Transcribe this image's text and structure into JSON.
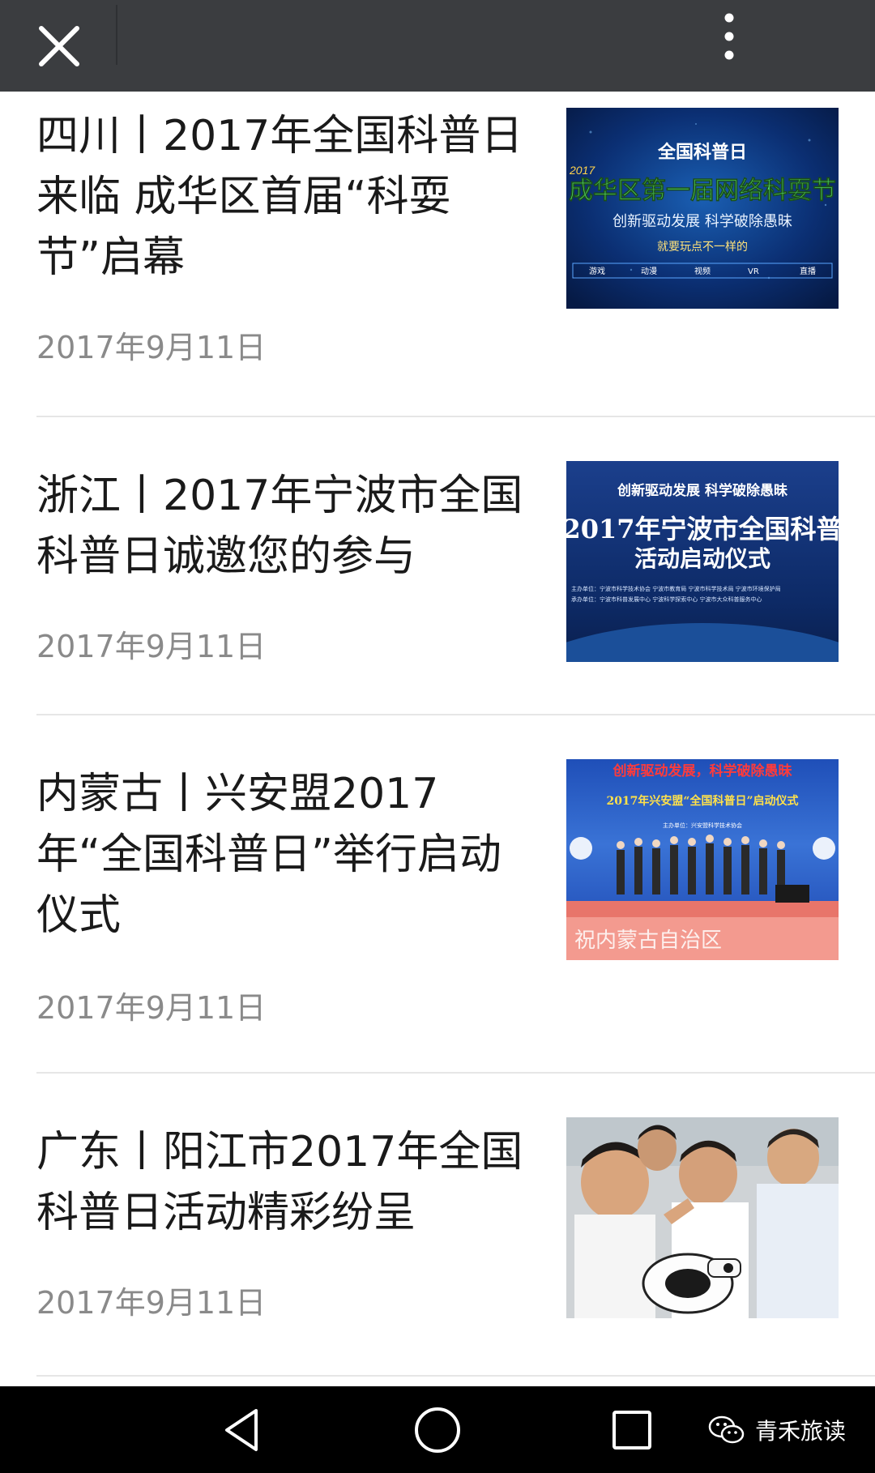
{
  "topbar": {
    "close_icon": "close-icon",
    "more_icon": "more-vertical-icon"
  },
  "articles": [
    {
      "title": "四川丨2017年全国科普日来临 成华区首届“科耍节”启幕",
      "date": "2017年9月11日",
      "thumbnail": {
        "year": "2017",
        "line1": "全国科普日",
        "line2": "成华区第一届网络科耍节",
        "line3": "创新驱动发展 科学破除愚昧",
        "line4": "就要玩点不一样的",
        "tabs": [
          "游戏",
          "动漫",
          "视频",
          "VR",
          "直播"
        ]
      }
    },
    {
      "title": "浙江丨2017年宁波市全国科普日诚邀您的参与",
      "date": "2017年9月11日",
      "thumbnail": {
        "line1": "创新驱动发展  科学破除愚昧",
        "line2": "2017年宁波市全国科普",
        "line3": "活动启动仪式",
        "line4": "主办单位：宁波市科学技术协会  宁波市教育局  宁波市科学技术局  宁波市环境保护局",
        "line5": "承办单位：宁波市科普发展中心  宁波科学探索中心  宁波市大众科普服务中心"
      }
    },
    {
      "title": "内蒙古丨兴安盟2017年“全国科普日”举行启动仪式",
      "date": "2017年9月11日",
      "thumbnail": {
        "line1": "创新驱动发展，科学破除愚昧",
        "line2": "2017年兴安盟“全国科普日”启动仪式",
        "line3": "主办单位：兴安盟科学技术协会",
        "line4": "祝内蒙古自治区"
      }
    },
    {
      "title": "广东丨阳江市2017年全国科普日活动精彩纷呈",
      "date": "2017年9月11日",
      "thumbnail": {
        "photo": "children-with-robot-photo"
      }
    }
  ],
  "navbar": {
    "back_icon": "back-triangle-icon",
    "home_icon": "home-circle-icon",
    "recents_icon": "recents-square-icon",
    "watermark_text": "青禾旅读"
  }
}
